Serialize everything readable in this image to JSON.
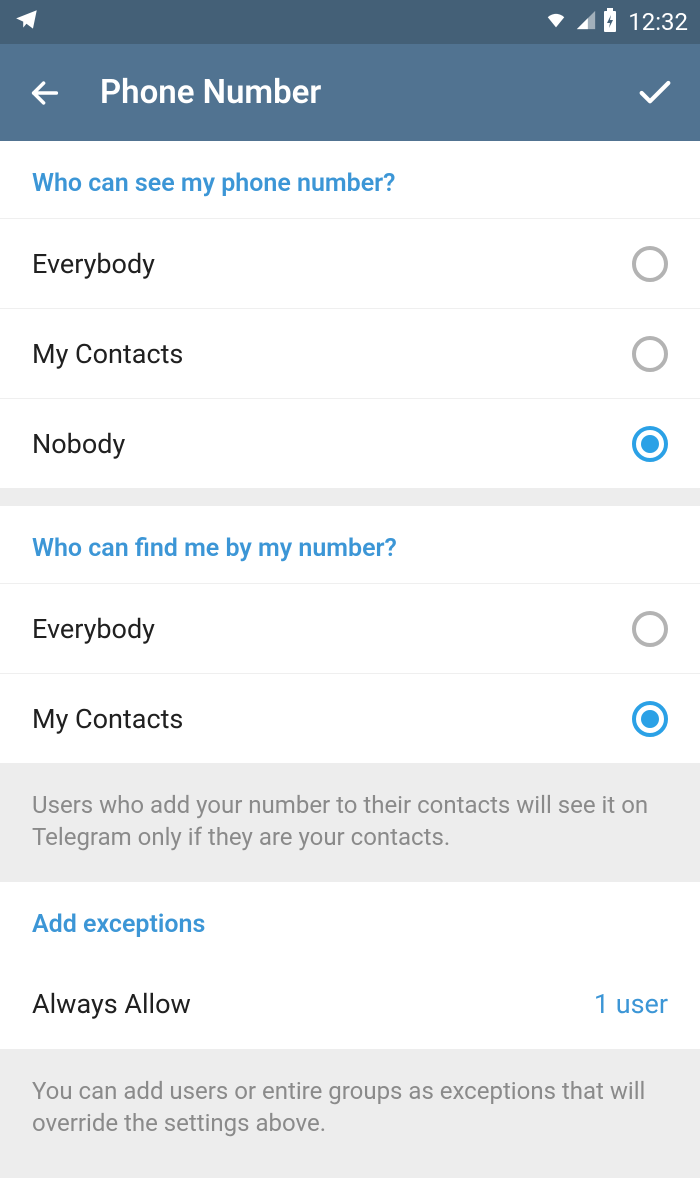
{
  "status_bar": {
    "time": "12:32"
  },
  "app_bar": {
    "title": "Phone Number"
  },
  "sections": {
    "see": {
      "header": "Who can see my phone number?",
      "options": [
        {
          "label": "Everybody",
          "selected": false
        },
        {
          "label": "My Contacts",
          "selected": false
        },
        {
          "label": "Nobody",
          "selected": true
        }
      ]
    },
    "find": {
      "header": "Who can find me by my number?",
      "options": [
        {
          "label": "Everybody",
          "selected": false
        },
        {
          "label": "My Contacts",
          "selected": true
        }
      ],
      "info": "Users who add your number to their contacts will see it on Telegram only if they are your contacts."
    },
    "exceptions": {
      "header": "Add exceptions",
      "items": [
        {
          "label": "Always Allow",
          "value": "1 user"
        }
      ],
      "info": "You can add users or entire groups as exceptions that will override the settings above."
    }
  }
}
